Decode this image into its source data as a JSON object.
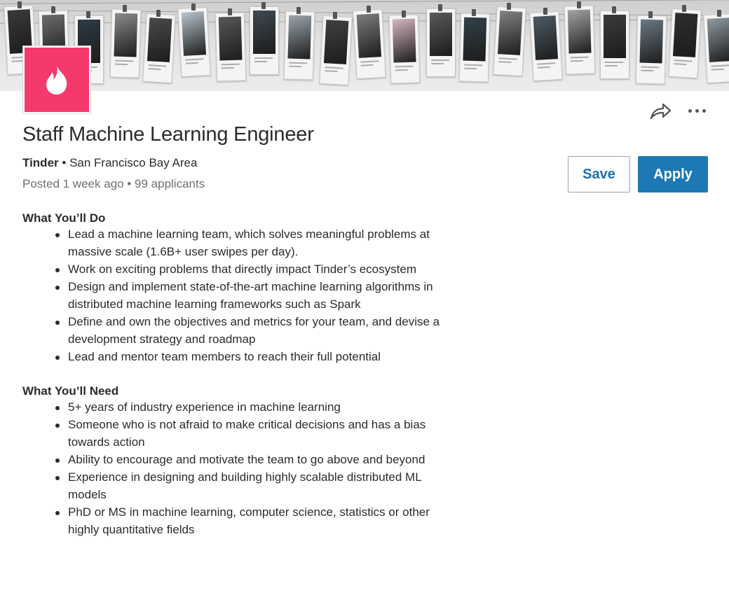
{
  "job": {
    "title": "Staff Machine Learning Engineer",
    "company": "Tinder",
    "separator": "•",
    "location": "San Francisco Bay Area",
    "posted": "Posted 1 week ago",
    "applicants": "99 applicants"
  },
  "actions": {
    "save_label": "Save",
    "apply_label": "Apply"
  },
  "colors": {
    "brand": "#f53a6b",
    "accent": "#1e78b4"
  },
  "icons": {
    "logo": "tinder-flame-icon",
    "share": "share-arrow-icon",
    "more": "more-horizontal-icon"
  },
  "sections": [
    {
      "heading": "What You’ll Do",
      "items": [
        "Lead a machine learning team, which solves meaningful problems at massive scale (1.6B+ user swipes per day).",
        "Work on exciting problems that directly impact Tinder’s ecosystem",
        "Design and implement state-of-the-art machine learning algorithms in distributed machine learning frameworks such as Spark",
        "Define and own the objectives and metrics for your team, and devise a development strategy and roadmap",
        "Lead and mentor team members to reach their full potential"
      ]
    },
    {
      "heading": "What You’ll Need",
      "items": [
        "5+ years of industry experience in machine learning",
        "Someone who is not afraid to make critical decisions and has a bias towards action",
        "Ability to encourage and motivate the team to go above and beyond",
        "Experience in designing and building highly scalable distributed ML models",
        "PhD or MS in machine learning, computer science, statistics or other highly quantitative fields"
      ]
    }
  ]
}
